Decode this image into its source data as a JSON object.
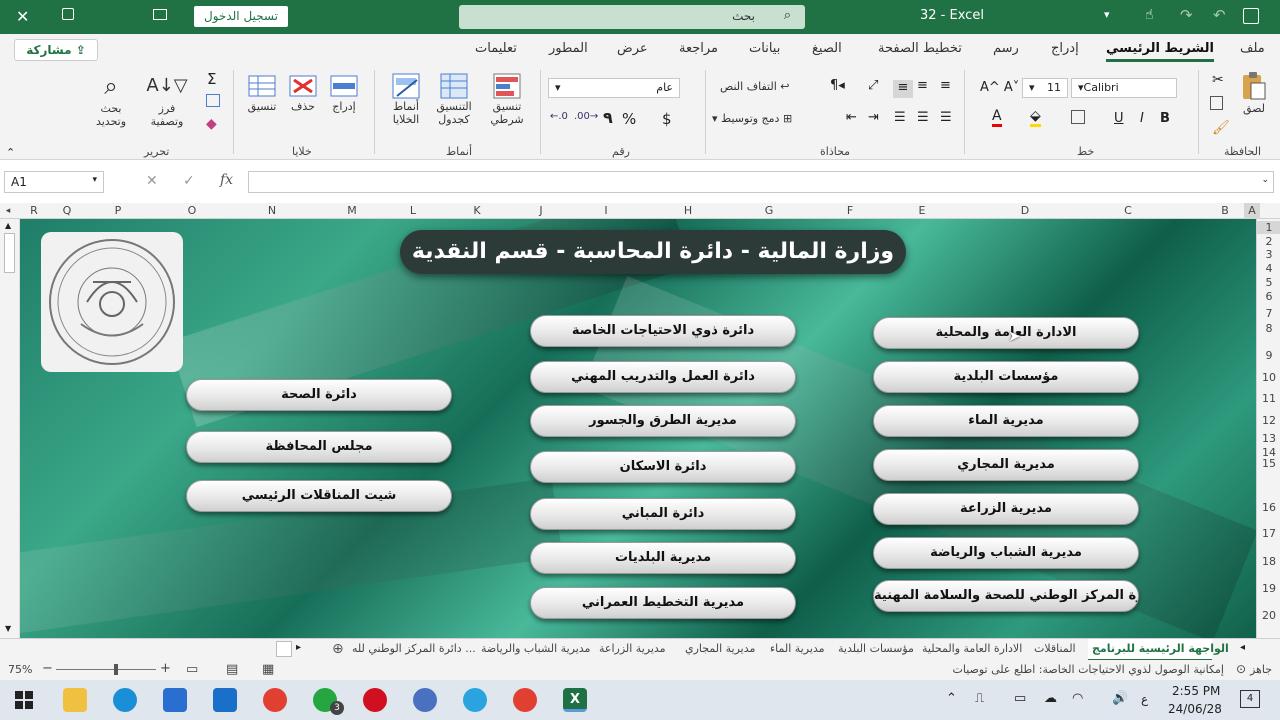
{
  "window": {
    "title": "32 - Excel",
    "signin": "تسجيل الدخول",
    "search_placeholder": "بحث"
  },
  "ribbon_tabs": [
    "ملف",
    "الشريط الرئيسي",
    "إدراج",
    "رسم",
    "تخطيط الصفحة",
    "الصيغ",
    "بيانات",
    "مراجعة",
    "عرض",
    "المطور",
    "تعليمات"
  ],
  "share_label": "مشاركة",
  "ribbon": {
    "clipboard": {
      "paste": "لصق",
      "group": "الحافظة"
    },
    "font": {
      "name": "Calibri",
      "size": "11",
      "group": "خط"
    },
    "alignment": {
      "wrap": "التفاف النص",
      "merge": "دمج وتوسيط",
      "group": "محاذاة"
    },
    "number": {
      "format": "عام",
      "group": "رقم",
      "currency": "$",
      "percent": "%",
      "comma": "٩"
    },
    "styles": {
      "conditional": "تنسيق شرطي",
      "as_table": "التنسيق كجدول",
      "cell_styles": "أنماط الخلايا",
      "group": "أنماط"
    },
    "cells": {
      "insert": "إدراج",
      "delete": "حذف",
      "format": "تنسيق",
      "group": "خلايا"
    },
    "editing": {
      "sort": "فرز وتصفية",
      "find": "بحث وتحديد",
      "group": "تحرير"
    }
  },
  "formula_bar": {
    "name_box": "A1",
    "fx": "fx",
    "value": ""
  },
  "columns": [
    "A",
    "B",
    "C",
    "D",
    "E",
    "F",
    "G",
    "H",
    "I",
    "J",
    "K",
    "L",
    "M",
    "N",
    "O",
    "P",
    "Q",
    "R"
  ],
  "rows": [
    "1",
    "2",
    "3",
    "4",
    "5",
    "6",
    "7",
    "8",
    "9",
    "10",
    "11",
    "12",
    "13",
    "14",
    "15",
    "16",
    "17",
    "18",
    "19",
    "20"
  ],
  "sheet": {
    "banner": "وزارة المالية - دائرة المحاسبة - قسم النقدية",
    "col_right": [
      "الادارة العامة والمحلية",
      "مؤسسات البلدية",
      "مديرية الماء",
      "مديرية المجاري",
      "مديرية الزراعة",
      "مديرية الشباب والرياضة",
      "دائرة المركز الوطني للصحة والسلامة المهنية"
    ],
    "col_middle": [
      "دائرة ذوي الاحتياجات الخاصة",
      "دائرة العمل والتدريب المهني",
      "مديرية الطرق والجسور",
      "دائرة الاسكان",
      "دائرة المباني",
      "مديرية البلديات",
      "مديرية التخطيط العمراني"
    ],
    "col_left": [
      "دائرة الصحة",
      "مجلس المحافظة",
      "شيت المناقلات الرئيسي"
    ]
  },
  "sheet_tabs": [
    "الواجهة الرئيسية للبرنامج",
    "المناقلات",
    "الادارة العامة والمحلية",
    "مؤسسات البلدية",
    "مديرية الماء",
    "مديرية المجاري",
    "مديرية الزراعة",
    "مديرية الشباب والرياضة",
    "دائرة المركز الوطني لله ..."
  ],
  "status": {
    "ready": "جاهز",
    "accessibility": "إمكانية الوصول لذوي الاحتياجات الخاصة: اطلع على توصيات",
    "zoom": "75%"
  },
  "taskbar": {
    "time": "2:55 PM",
    "date": "24/06/28",
    "lang": "ع",
    "notifications": "4",
    "whatsapp_badge": "3"
  },
  "colors": {
    "excel_green": "#207245",
    "sheet_bg": "#2e9a7d"
  }
}
